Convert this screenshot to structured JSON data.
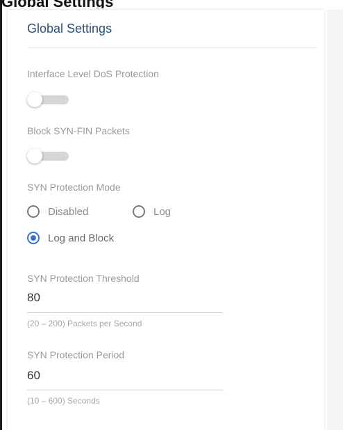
{
  "page": {
    "header_text": "Global Settings"
  },
  "card": {
    "title": "Global Settings",
    "dos_protection": {
      "label": "Interface Level DoS Protection",
      "enabled": false
    },
    "block_syn_fin": {
      "label": "Block SYN-FIN Packets",
      "enabled": false
    },
    "syn_mode": {
      "label": "SYN Protection Mode",
      "options": [
        "Disabled",
        "Log",
        "Log and Block"
      ],
      "selected": "Log and Block"
    },
    "syn_threshold": {
      "label": "SYN Protection Threshold",
      "value": "80",
      "hint": "(20 – 200) Packets per Second"
    },
    "syn_period": {
      "label": "SYN Protection Period",
      "value": "60",
      "hint": "(10 – 600) Seconds"
    }
  },
  "colors": {
    "title": "#2b4f7a",
    "accent": "#3b6fd8",
    "label": "#9a9a9a"
  }
}
